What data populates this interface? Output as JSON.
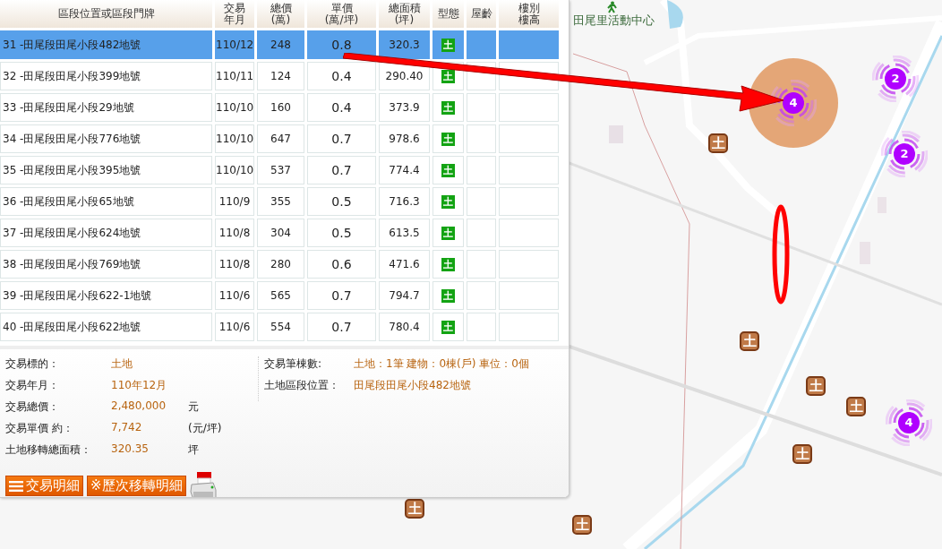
{
  "table": {
    "columns": [
      "區段位置或區段門牌",
      "交易年月",
      "總價\n(萬)",
      "單價\n(萬/坪)",
      "總面積\n(坪)",
      "型態",
      "屋齡",
      "樓別樓高"
    ],
    "rows": [
      {
        "address": "31  -田尾段田尾小段482地號",
        "date": "110/12",
        "total": "248",
        "unit": "0.8",
        "area": "320.3",
        "type": "土",
        "selected": true
      },
      {
        "address": "32  -田尾段田尾小段399地號",
        "date": "110/11",
        "total": "124",
        "unit": "0.4",
        "area": "290.40",
        "type": "土",
        "selected": false
      },
      {
        "address": "33  -田尾段田尾小段29地號",
        "date": "110/10",
        "total": "160",
        "unit": "0.4",
        "area": "373.9",
        "type": "土",
        "selected": false
      },
      {
        "address": "34  -田尾段田尾小段776地號",
        "date": "110/10",
        "total": "647",
        "unit": "0.7",
        "area": "978.6",
        "type": "土",
        "selected": false
      },
      {
        "address": "35  -田尾段田尾小段395地號",
        "date": "110/10",
        "total": "537",
        "unit": "0.7",
        "area": "774.4",
        "type": "土",
        "selected": false
      },
      {
        "address": "36  -田尾段田尾小段65地號",
        "date": "110/9",
        "total": "355",
        "unit": "0.5",
        "area": "716.3",
        "type": "土",
        "selected": false
      },
      {
        "address": "37  -田尾段田尾小段624地號",
        "date": "110/8",
        "total": "304",
        "unit": "0.5",
        "area": "613.5",
        "type": "土",
        "selected": false
      },
      {
        "address": "38  -田尾段田尾小段769地號",
        "date": "110/8",
        "total": "280",
        "unit": "0.6",
        "area": "471.6",
        "type": "土",
        "selected": false
      },
      {
        "address": "39  -田尾段田尾小段622-1地號",
        "date": "110/6",
        "total": "565",
        "unit": "0.7",
        "area": "794.7",
        "type": "土",
        "selected": false
      },
      {
        "address": "40  -田尾段田尾小段622地號",
        "date": "110/6",
        "total": "554",
        "unit": "0.7",
        "area": "780.4",
        "type": "土",
        "selected": false
      }
    ]
  },
  "details": {
    "left": [
      {
        "label": "交易標的：",
        "value": "土地"
      },
      {
        "label": "交易年月：",
        "value": "110年12月"
      },
      {
        "label": "交易總價：",
        "value": "2,480,000",
        "unit": "元"
      },
      {
        "label": "交易單價 約：",
        "value": "7,742",
        "unit": "(元/坪)"
      },
      {
        "label": "土地移轉總面積：",
        "value": "320.35",
        "unit": "坪"
      }
    ],
    "right": [
      {
        "label": "交易筆棟數:",
        "value": "土地：1筆 建物：0棟(戶) 車位：0個"
      },
      {
        "label": "土地區段位置：",
        "value": "田尾段田尾小段482地號"
      }
    ]
  },
  "buttons": [
    {
      "label": "交易明細",
      "kind": "list"
    },
    {
      "label": "※歷次移轉明細",
      "kind": "plain"
    }
  ],
  "map": {
    "poi": "田尾里活動中心",
    "clusters": [
      {
        "count": "4"
      },
      {
        "count": "2"
      },
      {
        "count": "2"
      },
      {
        "count": "4"
      }
    ],
    "land_markers": [
      "土",
      "土",
      "土",
      "土",
      "土",
      "土",
      "土"
    ]
  }
}
